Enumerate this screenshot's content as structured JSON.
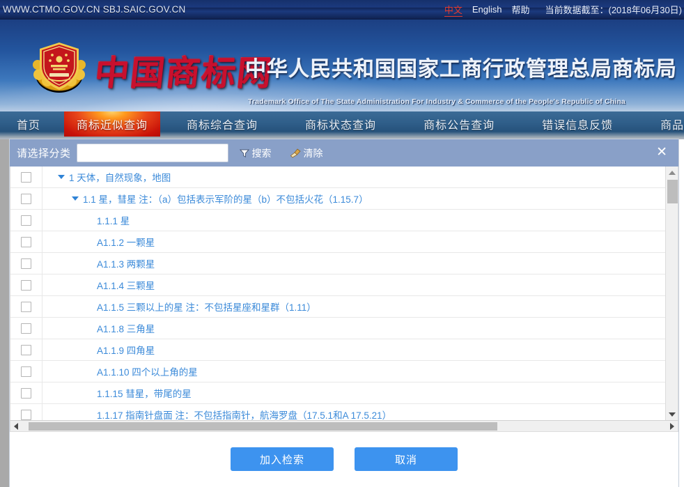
{
  "topbar": {
    "urls": "WWW.CTMO.GOV.CN SBJ.SAIC.GOV.CN",
    "lang_cn": "中文",
    "lang_en": "English",
    "help": "帮助",
    "data_asof": "当前数据截至：(2018年06月30日)"
  },
  "banner": {
    "emblem_icon": "national-emblem-icon",
    "logo_cn": "中国商标网",
    "org_cn": "中华人民共和国国家工商行政管理总局商标局",
    "org_en": "Trademark Office of The State Administration For Industry & Commerce of the People's Republic of China"
  },
  "nav": {
    "tabs": [
      {
        "label": "首页",
        "active": false
      },
      {
        "label": "商标近似查询",
        "active": true
      },
      {
        "label": "商标综合查询",
        "active": false
      },
      {
        "label": "商标状态查询",
        "active": false
      },
      {
        "label": "商标公告查询",
        "active": false
      },
      {
        "label": "错误信息反馈",
        "active": false
      },
      {
        "label": "商品/服务项目",
        "active": false
      }
    ]
  },
  "modal": {
    "head": {
      "label": "请选择分类",
      "input_value": "",
      "input_placeholder": "",
      "search_label": "搜索",
      "search_icon": "funnel-icon",
      "clear_label": "清除",
      "clear_icon": "broom-icon",
      "close_icon": "close-icon"
    },
    "rows": [
      {
        "level": 0,
        "expanded": true,
        "text": "1 天体，自然现象，地图"
      },
      {
        "level": 1,
        "expanded": true,
        "text": "1.1 星，彗星 注：（a）包括表示军阶的星（b）不包括火花（1.15.7）"
      },
      {
        "level": 2,
        "expanded": false,
        "text": "1.1.1 星"
      },
      {
        "level": 2,
        "expanded": false,
        "text": "A1.1.2 一颗星"
      },
      {
        "level": 2,
        "expanded": false,
        "text": "A1.1.3 两颗星"
      },
      {
        "level": 2,
        "expanded": false,
        "text": "A1.1.4 三颗星"
      },
      {
        "level": 2,
        "expanded": false,
        "text": "A1.1.5 三颗以上的星 注：不包括星座和星群（1.11）"
      },
      {
        "level": 2,
        "expanded": false,
        "text": "A1.1.8 三角星"
      },
      {
        "level": 2,
        "expanded": false,
        "text": "A1.1.9 四角星"
      },
      {
        "level": 2,
        "expanded": false,
        "text": "A1.1.10 四个以上角的星"
      },
      {
        "level": 2,
        "expanded": false,
        "text": "1.1.15 彗星，带尾的星"
      },
      {
        "level": 2,
        "expanded": false,
        "text": "1.1.17 指南针盘面 注：不包括指南针，航海罗盘（17.5.1和A 17.5.21）"
      }
    ],
    "footer": {
      "submit_label": "加入检索",
      "cancel_label": "取消"
    }
  },
  "colors": {
    "accent_blue": "#3d93ef",
    "link_blue": "#3b8ad9",
    "modal_head": "#89a0c8",
    "nav_active_red": "#c81208",
    "logo_red": "#c8102e"
  }
}
